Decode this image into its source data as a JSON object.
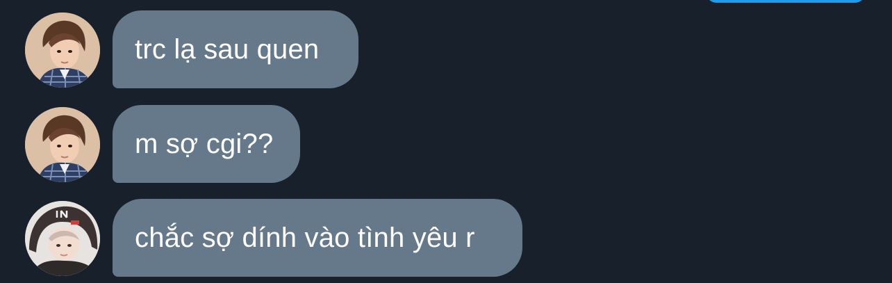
{
  "conversation": {
    "messages": [
      {
        "text": "trc lạ sau quen",
        "avatar": "avatar-brown-hair-icon"
      },
      {
        "text": "m sợ cgi??",
        "avatar": "avatar-brown-hair-icon"
      },
      {
        "text": "chắc sợ dính vào tình yêu r",
        "avatar": "avatar-hooded-icon"
      }
    ],
    "colors": {
      "background": "#17202b",
      "bubble_received": "#66798b",
      "bubble_sent": "#1d9bf0",
      "text": "#ffffff"
    }
  }
}
